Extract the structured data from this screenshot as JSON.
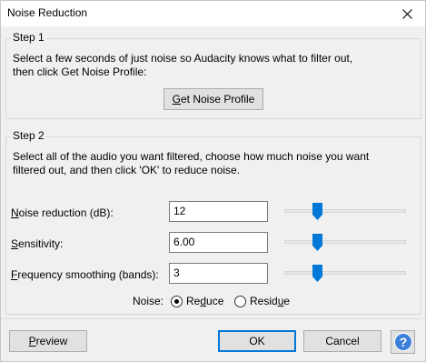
{
  "window": {
    "title": "Noise Reduction"
  },
  "step1": {
    "title": "Step 1",
    "instructions": "Select a few seconds of just noise so Audacity knows what to filter out,\nthen click Get Noise Profile:",
    "button_label_prefix": "G",
    "button_label_rest": "et Noise Profile"
  },
  "step2": {
    "title": "Step 2",
    "instructions": "Select all of the audio you want filtered, choose how much noise you want\nfiltered out, and then click 'OK' to reduce noise.",
    "fields": [
      {
        "label_ul": "N",
        "label_rest": "oise reduction (dB):",
        "value": "12",
        "slider_fraction": 0.27
      },
      {
        "label_ul": "S",
        "label_rest": "ensitivity:",
        "value": "6.00",
        "slider_fraction": 0.27
      },
      {
        "label_ul": "F",
        "label_rest": "requency smoothing (bands):",
        "value": "3",
        "slider_fraction": 0.27
      }
    ],
    "noise_label": "Noise:",
    "radio_reduce": {
      "pre": "Re",
      "ul": "d",
      "post": "uce",
      "checked": true
    },
    "radio_residue": {
      "pre": "Resid",
      "ul": "u",
      "post": "e",
      "checked": false
    }
  },
  "footer": {
    "preview_ul": "P",
    "preview_rest": "review",
    "ok_label": "OK",
    "cancel_label": "Cancel",
    "help_label": "?"
  },
  "colors": {
    "slider_thumb": "#0078d7",
    "help_icon": "#3c7fd8",
    "default_button_border": "#0078d7"
  },
  "icons": {
    "close": "close-icon",
    "help": "help-icon"
  }
}
